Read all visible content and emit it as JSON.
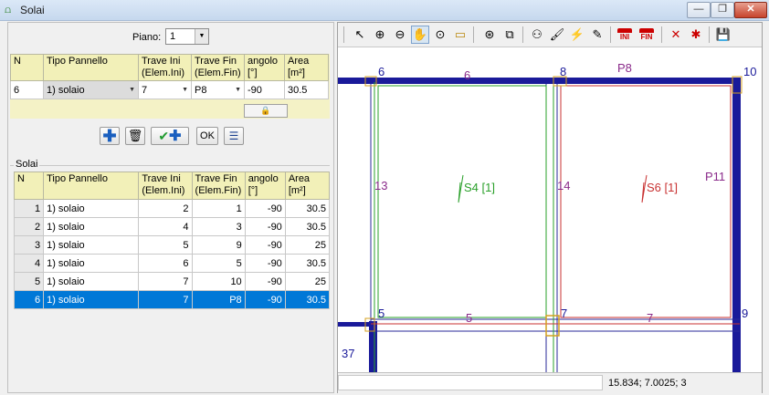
{
  "window": {
    "title": "Solai",
    "controls": {
      "minimize": "—",
      "restore": "❐",
      "close": "✕"
    }
  },
  "piano": {
    "label": "Piano:",
    "value": "1"
  },
  "editor": {
    "headers": [
      "N",
      "Tipo Pannello",
      "Trave Ini (Elem.Ini)",
      "Trave Fin (Elem.Fin)",
      "angolo [°]",
      "Area [m²]"
    ],
    "row": {
      "n": "6",
      "tipo": "1) solaio",
      "trave_ini": "7",
      "trave_fin": "P8",
      "angolo": "-90",
      "area": "30.5"
    },
    "lock_icon": "lock-icon"
  },
  "actions": {
    "add_icon": "plus-icon",
    "delete_icon": "trash-icon",
    "confirm_add_icon": "check-plus-icon",
    "ok_label": "OK",
    "list_icon": "list-icon"
  },
  "list": {
    "group_label": "Solai",
    "headers": [
      "N",
      "Tipo Pannello",
      "Trave Ini (Elem.Ini)",
      "Trave Fin (Elem.Fin)",
      "angolo [°]",
      "Area [m²]"
    ],
    "rows": [
      {
        "n": "1",
        "tipo": "1) solaio",
        "ini": "2",
        "fin": "1",
        "angolo": "-90",
        "area": "30.5"
      },
      {
        "n": "2",
        "tipo": "1) solaio",
        "ini": "4",
        "fin": "3",
        "angolo": "-90",
        "area": "30.5"
      },
      {
        "n": "3",
        "tipo": "1) solaio",
        "ini": "5",
        "fin": "9",
        "angolo": "-90",
        "area": "25"
      },
      {
        "n": "4",
        "tipo": "1) solaio",
        "ini": "6",
        "fin": "5",
        "angolo": "-90",
        "area": "30.5"
      },
      {
        "n": "5",
        "tipo": "1) solaio",
        "ini": "7",
        "fin": "10",
        "angolo": "-90",
        "area": "25"
      },
      {
        "n": "6",
        "tipo": "1) solaio",
        "ini": "7",
        "fin": "P8",
        "angolo": "-90",
        "area": "30.5"
      }
    ],
    "selected_row": "6"
  },
  "toolbar": {
    "tools": [
      "pointer-icon",
      "zoom-in-icon",
      "zoom-out-icon",
      "pan-icon",
      "zoom-window-icon",
      "ruler-icon",
      "zoom-extent-icon",
      "fit-icon",
      "node-icon",
      "brush-icon",
      "link-icon",
      "pen-icon",
      "ini-icon",
      "fin-icon",
      "delete-marker-icon",
      "star-marker-icon",
      "save-icon"
    ],
    "ini_label": "INI",
    "fin_label": "FIN"
  },
  "drawing": {
    "labels": {
      "n6": "6",
      "b6": "6",
      "n8": "8",
      "p8": "P8",
      "n10": "10",
      "b13": "13",
      "s4": "S4 [1]",
      "b14": "14",
      "s6": "S6 [1]",
      "p11": "P11",
      "n5": "5",
      "b5": "5",
      "n7": "7",
      "b7": "7",
      "n9": "9",
      "b37": "37"
    },
    "colors": {
      "blue": "#1a1a9a",
      "green": "#2aa02a",
      "red": "#c83232",
      "purple": "#8a2a8a"
    }
  },
  "status": {
    "coords": "15.834; 7.0025; 3"
  }
}
